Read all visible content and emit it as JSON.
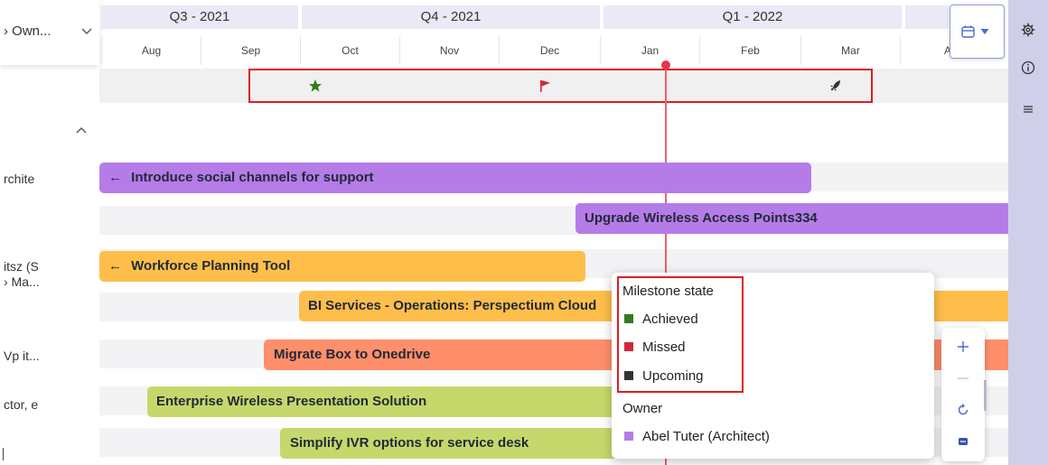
{
  "left_panel": {
    "owner_label": "› Own...",
    "labels": [
      "rchite",
      "itsz (S",
      "› Ma...",
      "Vp it...",
      "ctor, e"
    ]
  },
  "timeline": {
    "quarters": [
      "Q3 - 2021",
      "Q4 - 2021",
      "Q1 - 2022"
    ],
    "months": [
      "Aug",
      "Sep",
      "Oct",
      "Nov",
      "Dec",
      "Jan",
      "Feb",
      "Mar",
      "A"
    ]
  },
  "milestones": {
    "icons": [
      "star-icon",
      "flag-icon",
      "rocket-icon"
    ],
    "colors": {
      "achieved": "#2f7d1e",
      "missed": "#d0283a",
      "upcoming": "#3a3a3a"
    }
  },
  "bars": [
    {
      "label": "Introduce social channels for support",
      "arrow": "←",
      "color": "#b57ce8"
    },
    {
      "label": "Upgrade Wireless Access Points334",
      "arrow": "",
      "color": "#b57ce8"
    },
    {
      "label": "Workforce Planning Tool",
      "arrow": "←",
      "color": "#ffbe4a"
    },
    {
      "label": "BI Services - Operations: Perspectium Cloud",
      "arrow": "",
      "color": "#ffbe4a"
    },
    {
      "label": "Migrate Box to Onedrive",
      "arrow": "",
      "color": "#ff8e6b"
    },
    {
      "label": "Enterprise Wireless Presentation Solution",
      "arrow": "",
      "color": "#c6d86b"
    },
    {
      "label": "Simplify IVR options for service desk",
      "arrow": "",
      "color": "#c6d86b"
    }
  ],
  "legend": {
    "milestone_title": "Milestone state",
    "milestone_items": [
      {
        "label": "Achieved",
        "color": "#2f7d1e"
      },
      {
        "label": "Missed",
        "color": "#d0283a"
      },
      {
        "label": "Upcoming",
        "color": "#333333"
      }
    ],
    "owner_title": "Owner",
    "owner_items": [
      {
        "label": "Abel Tuter (Architect)",
        "color": "#b57ce8"
      }
    ]
  },
  "toolbar": {
    "view_button_icon": "calendar-icon",
    "rail_icons": [
      "gear-icon",
      "info-icon",
      "list-icon"
    ],
    "zoom_icons": [
      "zoom-in-icon",
      "zoom-out-icon",
      "reset-icon",
      "fit-view-icon"
    ]
  }
}
